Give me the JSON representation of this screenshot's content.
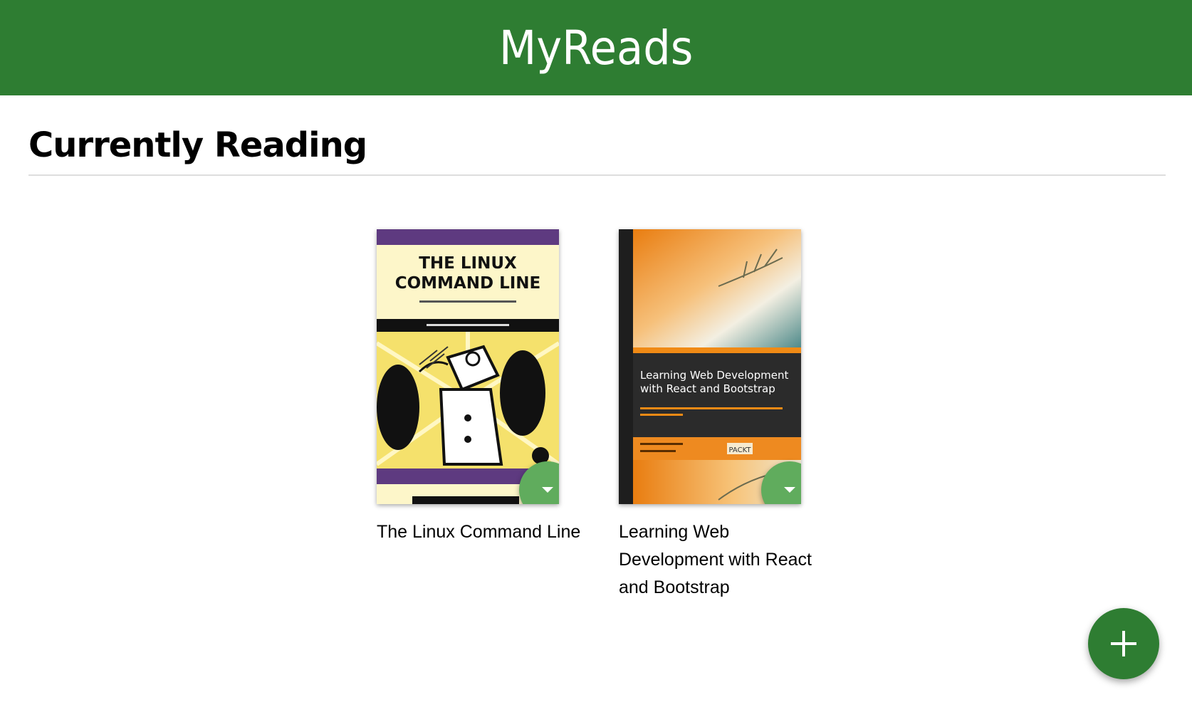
{
  "header": {
    "title": "MyReads"
  },
  "shelf": {
    "title": "Currently Reading",
    "books": [
      {
        "title": "The Linux Command Line",
        "cover": {
          "title_line1": "THE LINUX",
          "title_line2": "COMMAND LINE"
        }
      },
      {
        "title": "Learning Web Development with React and Bootstrap",
        "cover": {
          "title_line1": "Learning Web Development",
          "title_line2": "with React and Bootstrap",
          "publisher": "PACKT"
        }
      }
    ]
  },
  "icons": {
    "shelf_changer": "caret-down-icon",
    "add": "plus-icon"
  },
  "colors": {
    "header_bg": "#2e7d32",
    "changer_bg": "#60ac5d",
    "add_button_bg": "#2e7d32"
  }
}
